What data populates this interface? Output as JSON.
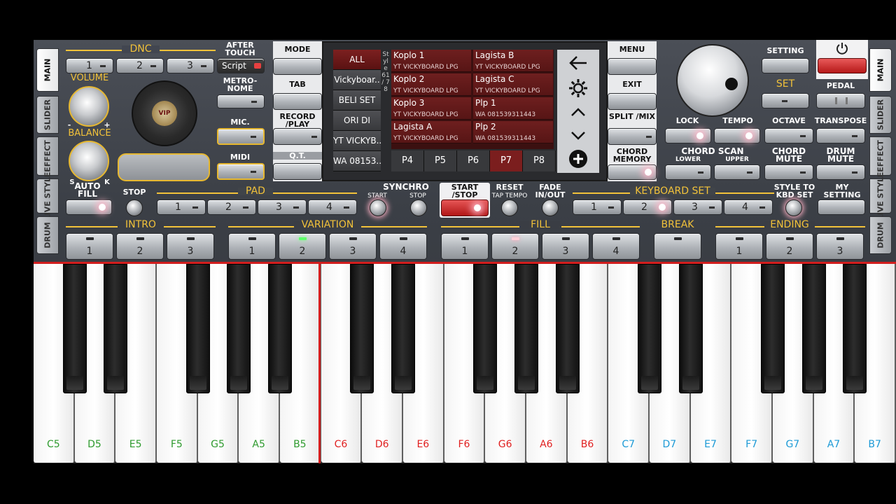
{
  "left_tabs": [
    "MAIN",
    "SLIDER",
    "EFFECT",
    "LIVE STYLE",
    "DRUM"
  ],
  "right_tabs": [
    "MAIN",
    "SLIDER",
    "EFFECT",
    "LIVE STYLE",
    "DRUM"
  ],
  "dnc": {
    "title": "DNC",
    "buttons": [
      "1",
      "2",
      "3"
    ]
  },
  "after_touch": {
    "label": "AFTER TOUCH",
    "value": "Script"
  },
  "volume_label": "VOLUME",
  "balance_label": "BALANCE",
  "balance_minus": "-",
  "balance_plus": "+",
  "balance_s": "S",
  "balance_k": "K",
  "logo_text": "VIP",
  "metronome_label": "METRO-NOME",
  "mic_label": "MIC.",
  "midi_label": "MIDI",
  "center_left_buttons": [
    "MODE",
    "TAB",
    "RECORD /PLAY",
    "Q.T."
  ],
  "style_browser": {
    "categories": [
      "ALL",
      "Vickyboar..",
      "BELI SET",
      "ORI DI",
      "YT VICKYB..",
      "WA 08153.."
    ],
    "vertical_label": "Style 61 / 78",
    "styles": [
      {
        "name": "Koplo 1",
        "sub": "YT VICKYBOARD LPG"
      },
      {
        "name": "Lagista B",
        "sub": "YT VICKYBOARD LPG"
      },
      {
        "name": "Koplo 2",
        "sub": "YT VICKYBOARD LPG"
      },
      {
        "name": "Lagista C",
        "sub": "YT VICKYBOARD LPG"
      },
      {
        "name": "Koplo 3",
        "sub": "YT VICKYBOARD LPG"
      },
      {
        "name": "Plp 1",
        "sub": "WA 081539311443"
      },
      {
        "name": "Lagista A",
        "sub": "YT VICKYBOARD LPG"
      },
      {
        "name": "Plp 2",
        "sub": "WA 081539311443"
      }
    ],
    "pages": [
      "P4",
      "P5",
      "P6",
      "P7",
      "P8"
    ],
    "active_page": "P7",
    "nav_icons": [
      "back-arrow",
      "gear",
      "chevron-up",
      "chevron-down",
      "plus"
    ]
  },
  "center_right_buttons": [
    "MENU",
    "EXIT",
    "SPLIT /MIX",
    "CHORD MEMORY"
  ],
  "setting_label": "SETTING",
  "set_label": "SET",
  "pedal_label": "PEDAL",
  "power_icon": "power-icon",
  "right_labels": {
    "lock": "LOCK",
    "tempo": "TEMPO",
    "octave": "OCTAVE",
    "transpose": "TRANSPOSE",
    "chord_scan": "CHORD SCAN",
    "lower": "LOWER",
    "upper": "UPPER",
    "chord_mute": "CHORD MUTE",
    "drum_mute": "DRUM MUTE"
  },
  "row2": {
    "auto_fill": "AUTO FILL",
    "stop": "STOP",
    "pad": "PAD",
    "pad_buttons": [
      "1",
      "2",
      "3",
      "4"
    ],
    "synchro": "SYNCHRO",
    "synchro_start": "START",
    "synchro_stop": "STOP",
    "start_stop": "START /STOP",
    "reset": "RESET",
    "tap_tempo": "TAP TEMPO",
    "fade": "FADE IN/OUT",
    "keyboard_set": "KEYBOARD SET",
    "kbd_buttons": [
      "1",
      "2",
      "3",
      "4"
    ],
    "style_to_kbd": "STYLE TO KBD SET",
    "my_setting": "MY SETTING"
  },
  "sections": {
    "intro": {
      "title": "INTRO",
      "buttons": [
        "1",
        "2",
        "3"
      ]
    },
    "variation": {
      "title": "VARIATION",
      "buttons": [
        "1",
        "2",
        "3",
        "4"
      ]
    },
    "fill": {
      "title": "FILL",
      "buttons": [
        "1",
        "2",
        "3",
        "4"
      ]
    },
    "break": {
      "title": "BREAK"
    },
    "ending": {
      "title": "ENDING",
      "buttons": [
        "1",
        "2",
        "3"
      ]
    }
  },
  "keys": [
    {
      "note": "C5",
      "color": "#2e9a2e"
    },
    {
      "note": "D5",
      "color": "#2e9a2e"
    },
    {
      "note": "E5",
      "color": "#2e9a2e"
    },
    {
      "note": "F5",
      "color": "#2e9a2e"
    },
    {
      "note": "G5",
      "color": "#2e9a2e"
    },
    {
      "note": "A5",
      "color": "#2e9a2e"
    },
    {
      "note": "B5",
      "color": "#2e9a2e"
    },
    {
      "note": "C6",
      "color": "#e02020"
    },
    {
      "note": "D6",
      "color": "#e02020"
    },
    {
      "note": "E6",
      "color": "#e02020"
    },
    {
      "note": "F6",
      "color": "#e02020"
    },
    {
      "note": "G6",
      "color": "#e02020"
    },
    {
      "note": "A6",
      "color": "#e02020"
    },
    {
      "note": "B6",
      "color": "#e02020"
    },
    {
      "note": "C7",
      "color": "#1c9ad6"
    },
    {
      "note": "D7",
      "color": "#1c9ad6"
    },
    {
      "note": "E7",
      "color": "#1c9ad6"
    },
    {
      "note": "F7",
      "color": "#1c9ad6"
    },
    {
      "note": "G7",
      "color": "#1c9ad6"
    },
    {
      "note": "A7",
      "color": "#1c9ad6"
    },
    {
      "note": "B7",
      "color": "#1c9ad6"
    }
  ],
  "colors": {
    "gold": "#f2c23a",
    "red_accent": "#d21e1e",
    "panel": "#3b3f46"
  }
}
